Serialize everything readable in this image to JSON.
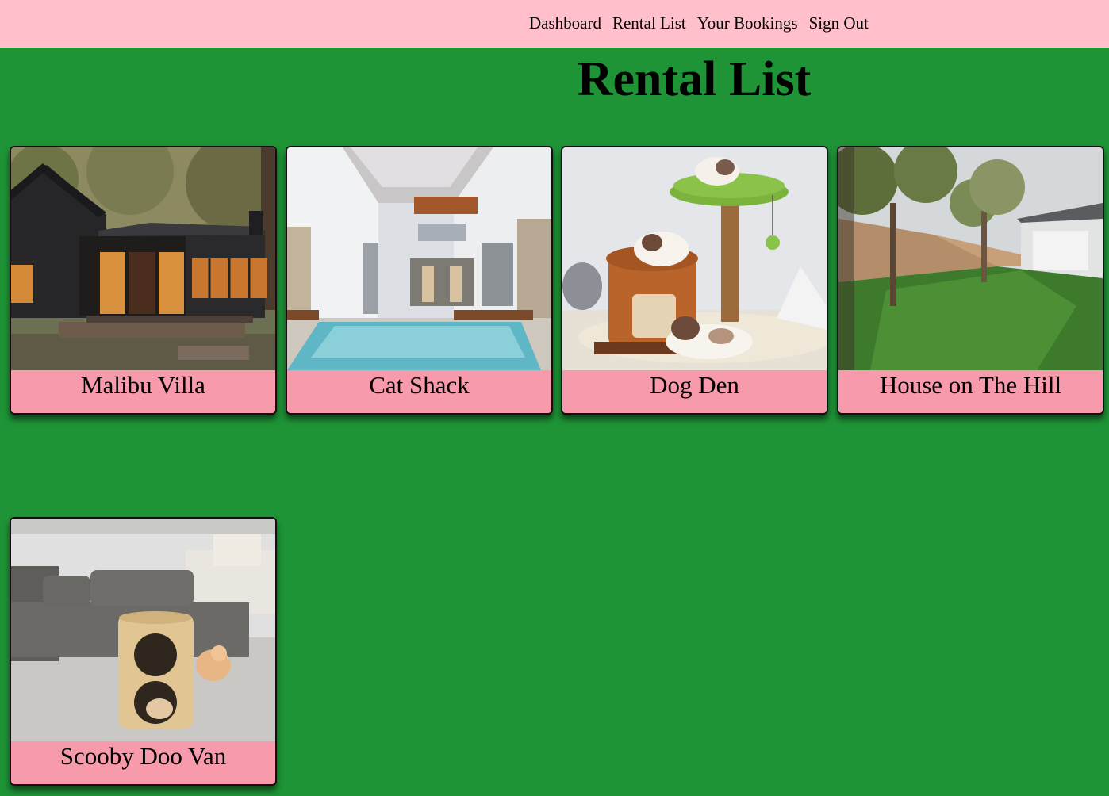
{
  "nav": {
    "links": [
      {
        "label": "Dashboard"
      },
      {
        "label": "Rental List"
      },
      {
        "label": "Your Bookings"
      },
      {
        "label": "Sign Out"
      }
    ]
  },
  "page": {
    "title": "Rental List"
  },
  "rentals": [
    {
      "name": "Malibu Villa"
    },
    {
      "name": "Cat Shack"
    },
    {
      "name": "Dog Den"
    },
    {
      "name": "House on The Hill"
    },
    {
      "name": "Scooby Doo Van"
    }
  ],
  "colors": {
    "page_background": "#1e9436",
    "navbar_background": "#ffc0cb",
    "card_label_background": "#f79aab"
  }
}
